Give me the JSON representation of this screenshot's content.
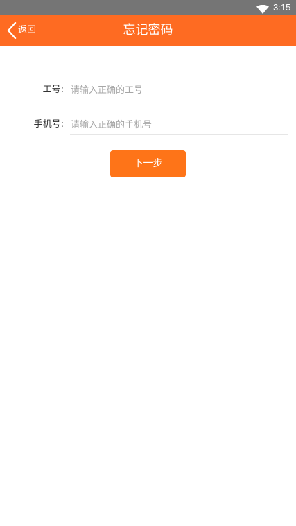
{
  "status_bar": {
    "time": "3:15",
    "icons": [
      "wifi-icon"
    ]
  },
  "header": {
    "back_label": "返回",
    "title": "忘记密码",
    "back_icon": "chevron-left-icon"
  },
  "form": {
    "employee_id": {
      "label": "工号:",
      "value": "",
      "placeholder": "请输入正确的工号"
    },
    "phone": {
      "label": "手机号:",
      "value": "",
      "placeholder": "请输入正确的手机号"
    }
  },
  "actions": {
    "next_label": "下一步"
  },
  "colors": {
    "accent": "#fe6b22",
    "button": "#fe7418",
    "status_bar": "#757575",
    "placeholder": "#a6a6a6",
    "divider": "#e6e6e6"
  }
}
